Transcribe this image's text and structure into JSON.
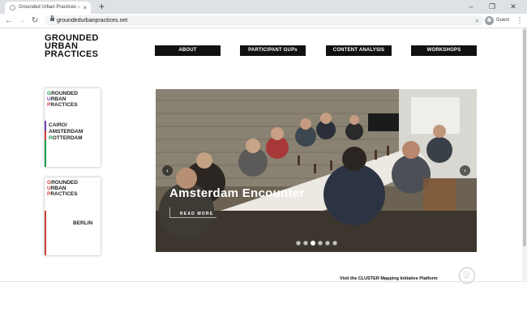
{
  "browser": {
    "tab_title": "Grounded Urban Practices – GUP",
    "tab_close": "×",
    "new_tab": "+",
    "window_controls": {
      "minimize": "–",
      "restore": "❐",
      "close": "✕"
    },
    "nav": {
      "back": "←",
      "forward": "→",
      "reload": "↻"
    },
    "url": "groundedurbanpractices.net",
    "zoom_icon": "⌕",
    "profile_name": "Guest",
    "menu": "⋮"
  },
  "site": {
    "logo": [
      "GROUNDED",
      "URBAN",
      "PRACTICES"
    ],
    "nav": [
      "ABOUT",
      "PARTICIPANT GUPs",
      "CONTENT ANALYSIS",
      "WORKSHOPS"
    ]
  },
  "cards": [
    {
      "title_initials": [
        "G",
        "U",
        "P"
      ],
      "title_rest": [
        "ROUNDED",
        "RBAN",
        "RACTICES"
      ],
      "places": [
        [
          "",
          "CAIRO/"
        ],
        [
          "",
          "AMSTERDAM"
        ],
        [
          "R",
          "OTTERDAM"
        ]
      ]
    },
    {
      "title_initials": [
        "G",
        "U",
        "P"
      ],
      "title_rest": [
        "ROUNDED",
        "RBAN",
        "RACTICES"
      ],
      "place": "BERLIN"
    }
  ],
  "slider": {
    "title": "Amsterdam Encounter",
    "read_more": "READ MORE",
    "prev": "‹",
    "next": "›",
    "dot_count": 6,
    "active_dot": 2
  },
  "footer": {
    "link": "Visit the CLUSTER Mapping Initiative Platform",
    "badge_top": "CU",
    "badge_bottom": "IP"
  },
  "colors": {
    "green": "#1a9e52",
    "purple": "#6e3fae",
    "red": "#c8423a"
  }
}
